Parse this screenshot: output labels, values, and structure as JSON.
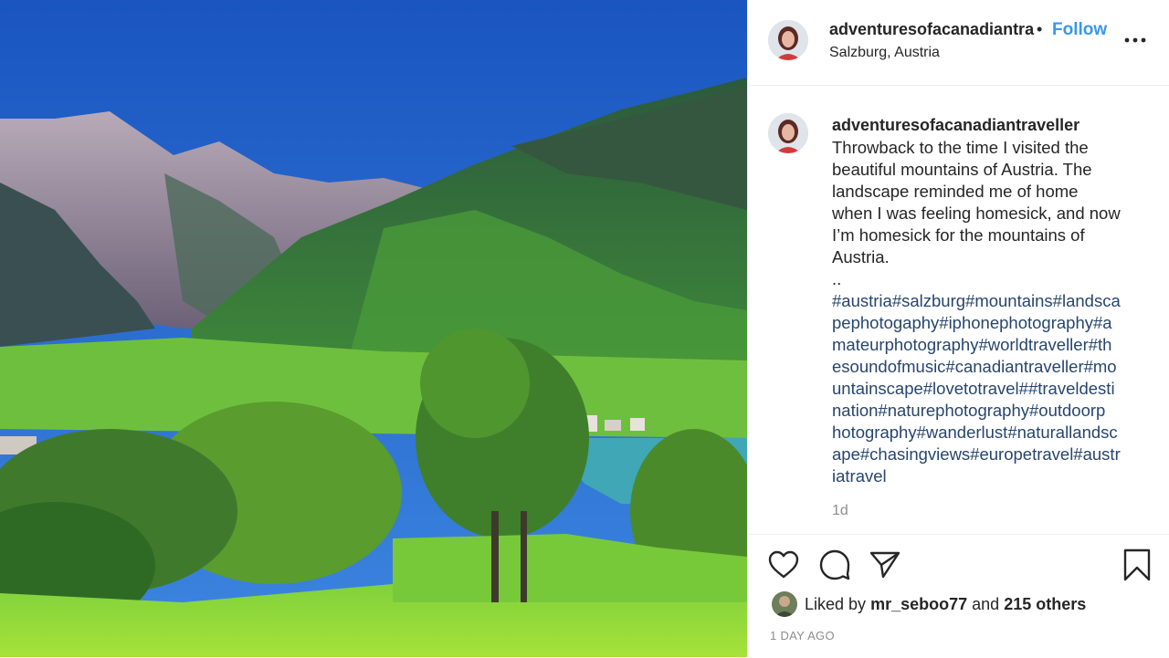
{
  "post": {
    "username": "adventuresofacanadiantra",
    "separator": "•",
    "follow_label": "Follow",
    "location": "Salzburg, Austria",
    "more_icon": "more-horizontal-icon"
  },
  "caption": {
    "username": "adventuresofacanadiantraveller",
    "text_lines": [
      "Throwback to the time I visited the",
      "beautiful mountains of Austria. The",
      "landscape reminded me of home",
      "when I was feeling homesick, and now",
      "I’m homesick for the mountains of",
      "Austria."
    ],
    "dots": "..",
    "hashtag_lines": [
      "#austria#salzburg#mountains#landsca",
      "pephotogaphy#iphonephotography#a",
      "mateurphotography#worldtraveller#th",
      "esoundofmusic#canadiantraveller#mo",
      "untainscape#lovetotravel##traveldesti",
      "nation#naturephotography#outdoorp",
      "hotography#wanderlust#naturallandsc",
      "ape#chasingviews#europetravel#austr",
      "iatravel"
    ],
    "time": "1d"
  },
  "actions": {
    "like_icon": "heart-icon",
    "comment_icon": "comment-icon",
    "share_icon": "share-icon",
    "save_icon": "bookmark-icon"
  },
  "likes": {
    "prefix": "Liked by",
    "user": "mr_seboo77",
    "middle": "and",
    "others": "215 others"
  },
  "timestamp": "1 DAY AGO",
  "colors": {
    "follow": "#3897f0",
    "hashtag": "#27466e",
    "muted": "#8e8e8e",
    "sky": "#1d5fc4"
  }
}
